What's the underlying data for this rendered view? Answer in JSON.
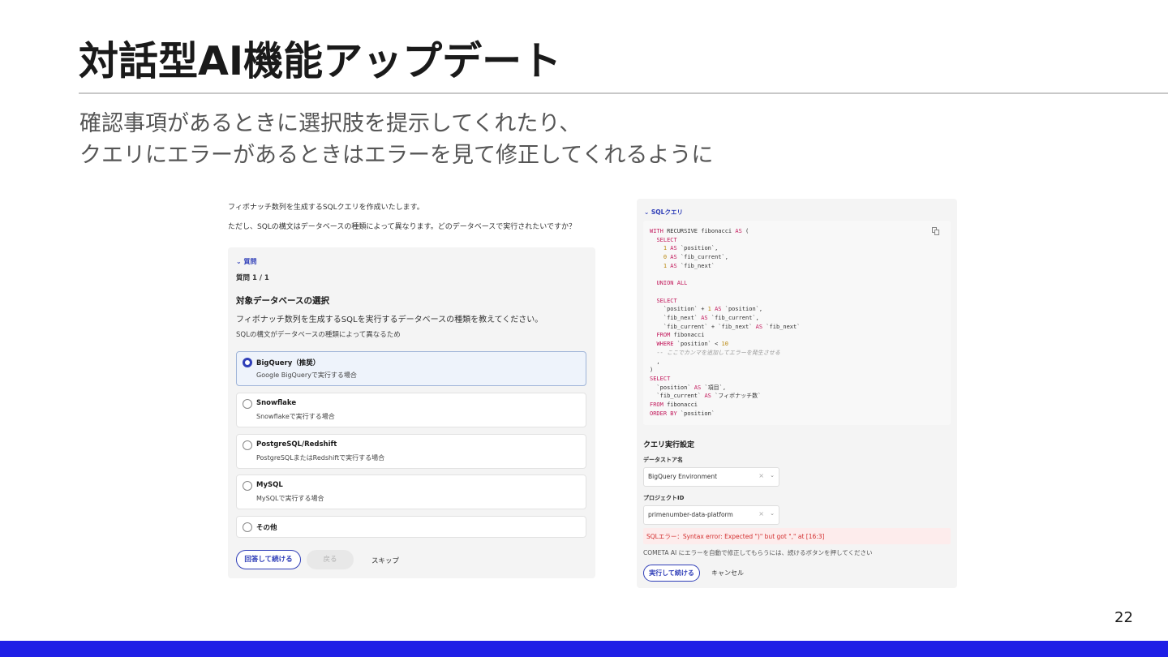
{
  "slide": {
    "title": "対話型AI機能アップデート",
    "subtitle_line1": "確認事項があるときに選択肢を提示してくれたり、",
    "subtitle_line2": "クエリにエラーがあるときはエラーを見て修正してくれるように",
    "page_number": "22",
    "footer_color": "#1f1fe6"
  },
  "left": {
    "intro1": "フィボナッチ数列を生成するSQLクエリを作成いたします。",
    "intro2": "ただし、SQLの構文はデータベースの種類によって異なります。どのデータベースで実行されたいですか？",
    "toggle": "⌄ 質問",
    "count": "質問 1 / 1",
    "question_title": "対象データベースの選択",
    "question_desc": "フィボナッチ数列を生成するSQLを実行するデータベースの種類を教えてください。",
    "question_note": "SQLの構文がデータベースの種類によって異なるため",
    "options": [
      {
        "label": "BigQuery（推奨）",
        "sub": "Google BigQueryで実行する場合"
      },
      {
        "label": "Snowflake",
        "sub": "Snowflakeで実行する場合"
      },
      {
        "label": "PostgreSQL/Redshift",
        "sub": "PostgreSQLまたはRedshiftで実行する場合"
      },
      {
        "label": "MySQL",
        "sub": "MySQLで実行する場合"
      },
      {
        "label": "その他",
        "sub": ""
      }
    ],
    "continue_button": "回答して続ける",
    "back_button": "戻る",
    "skip_button": "スキップ"
  },
  "right": {
    "toggle": "⌄ SQLクエリ",
    "settings_title": "クエリ実行設定",
    "datastore_label": "データストア名",
    "datastore_value": "BigQuery Environment",
    "project_label": "プロジェクトID",
    "project_value": "primenumber-data-platform",
    "clear_glyph": "×",
    "chevron_glyph": "⌄",
    "error_text": "SQLエラー：Syntax error: Expected \")\" but got \",\" at [16:3]",
    "hint_text": "COMETA AI にエラーを自動で修正してもらうには、続けるボタンを押してください",
    "run_button": "実行して続ける",
    "cancel_button": "キャンセル"
  },
  "accent_color": "#2f3eb8"
}
